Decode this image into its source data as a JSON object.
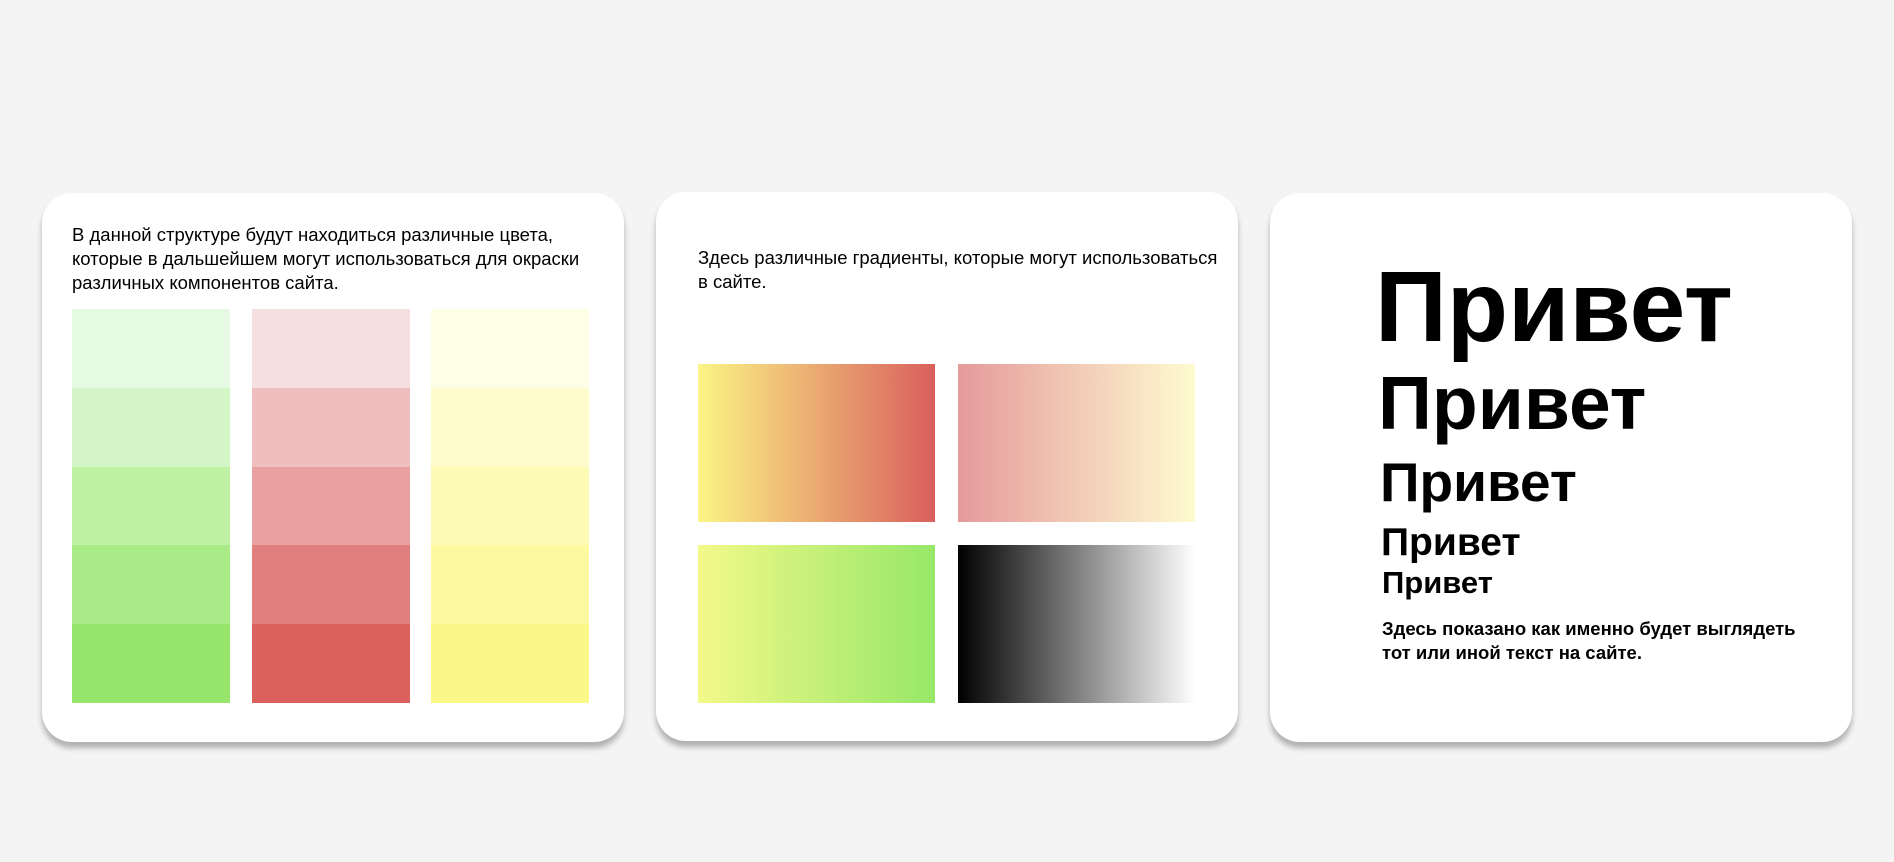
{
  "colors_card": {
    "description": "В данной структуре будут находиться различные цвета, которые в дальшейшем могут использоваться для окраски различных компонентов сайта.",
    "palettes": [
      {
        "name": "green",
        "shades": [
          "#e6f9e2",
          "#d5f7c8",
          "#c0f2a3",
          "#a9ec87",
          "#97e56a"
        ]
      },
      {
        "name": "red",
        "shades": [
          "#f5dfe0",
          "#efbfc0",
          "#e8a1a0",
          "#e17f7e",
          "#da615e"
        ]
      },
      {
        "name": "yellow",
        "shades": [
          "#fefde6",
          "#fefccd",
          "#fdfbb5",
          "#fcfaa0",
          "#fbf88a"
        ]
      }
    ]
  },
  "gradients_card": {
    "description": "Здесь различные градиенты, которые могут использоваться в сайте.",
    "gradients": [
      {
        "from": "#fbf585",
        "to": "#d95f5d"
      },
      {
        "from": "#e59a9b",
        "to": "#fefbd0"
      },
      {
        "from": "#f3f989",
        "to": "#96e768"
      },
      {
        "from": "#000000",
        "to": "#ffffff"
      }
    ]
  },
  "typography_card": {
    "samples": [
      "Привет",
      "Привет",
      "Привет",
      "Привет",
      "Привет"
    ],
    "caption": "Здесь показано как именно будет выглядеть тот или иной текст на сайте."
  }
}
